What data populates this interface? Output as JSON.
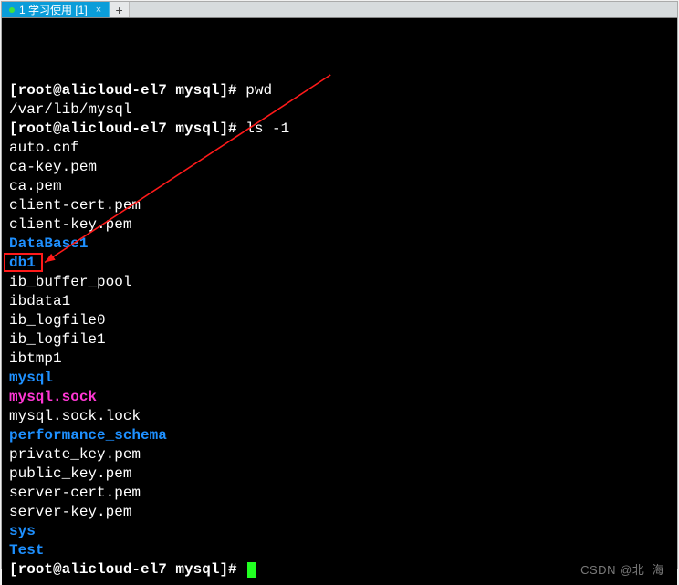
{
  "tabbar": {
    "active_tab_label": "1 学习使用 [1]",
    "active_tab_close": "×",
    "new_tab_label": "+"
  },
  "prompt": {
    "full": "[root@alicloud-el7 mysql]# "
  },
  "commands": {
    "pwd": "pwd",
    "pwd_output": "/var/lib/mysql",
    "ls": "ls -1"
  },
  "listing": [
    {
      "text": "auto.cnf",
      "class": "white"
    },
    {
      "text": "ca-key.pem",
      "class": "white"
    },
    {
      "text": "ca.pem",
      "class": "white"
    },
    {
      "text": "client-cert.pem",
      "class": "white"
    },
    {
      "text": "client-key.pem",
      "class": "white"
    },
    {
      "text": "DataBase1",
      "class": "blue bold"
    },
    {
      "text": "db1",
      "class": "blue bold"
    },
    {
      "text": "ib_buffer_pool",
      "class": "white"
    },
    {
      "text": "ibdata1",
      "class": "white"
    },
    {
      "text": "ib_logfile0",
      "class": "white"
    },
    {
      "text": "ib_logfile1",
      "class": "white"
    },
    {
      "text": "ibtmp1",
      "class": "white"
    },
    {
      "text": "mysql",
      "class": "blue bold"
    },
    {
      "text": "mysql.sock",
      "class": "magenta bold"
    },
    {
      "text": "mysql.sock.lock",
      "class": "white"
    },
    {
      "text": "performance_schema",
      "class": "blue bold"
    },
    {
      "text": "private_key.pem",
      "class": "white"
    },
    {
      "text": "public_key.pem",
      "class": "white"
    },
    {
      "text": "server-cert.pem",
      "class": "white"
    },
    {
      "text": "server-key.pem",
      "class": "white"
    },
    {
      "text": "sys",
      "class": "blue bold"
    },
    {
      "text": "Test",
      "class": "blue bold"
    }
  ],
  "highlight_target": "db1",
  "watermark": "CSDN @北  海"
}
